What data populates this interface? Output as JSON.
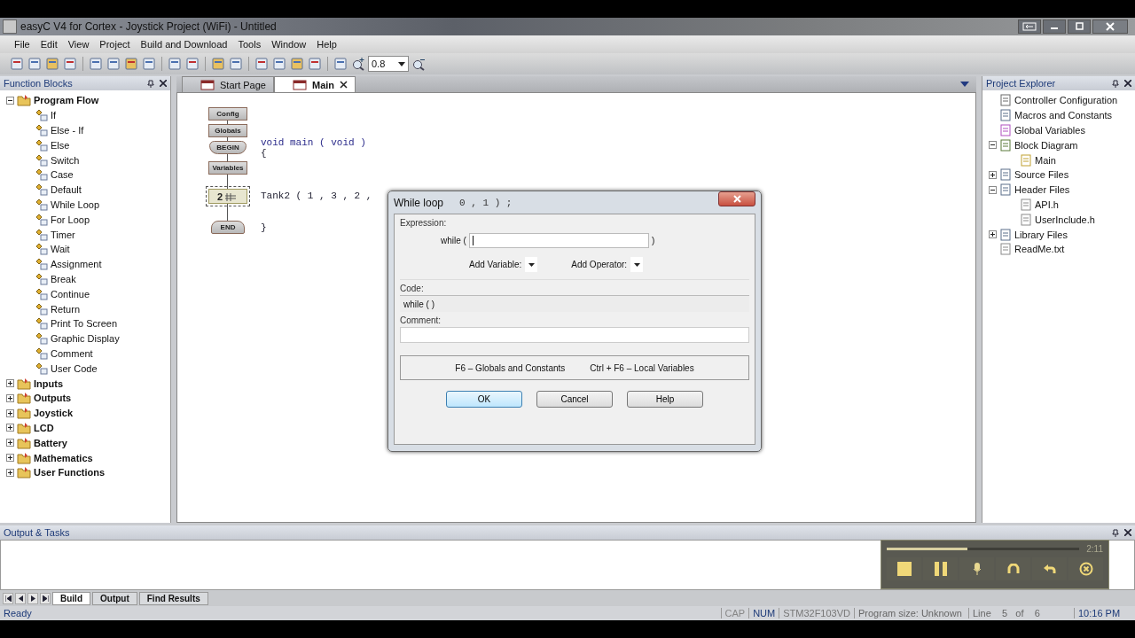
{
  "window": {
    "title": "easyC V4 for Cortex - Joystick Project (WiFi) - Untitled"
  },
  "menu": [
    "File",
    "Edit",
    "View",
    "Project",
    "Build and Download",
    "Tools",
    "Window",
    "Help"
  ],
  "toolbar": {
    "zoom_value": "0.8"
  },
  "function_blocks": {
    "title": "Function Blocks",
    "groups": [
      {
        "label": "Program Flow",
        "expanded": true,
        "children": [
          "If",
          "Else - If",
          "Else",
          "Switch",
          "Case",
          "Default",
          "While Loop",
          "For Loop",
          "Timer",
          "Wait",
          "Assignment",
          "Break",
          "Continue",
          "Return",
          "Print To Screen",
          "Graphic Display",
          "Comment",
          "User Code"
        ]
      },
      {
        "label": "Inputs",
        "expanded": false
      },
      {
        "label": "Outputs",
        "expanded": false
      },
      {
        "label": "Joystick",
        "expanded": false
      },
      {
        "label": "LCD",
        "expanded": false
      },
      {
        "label": "Battery",
        "expanded": false
      },
      {
        "label": "Mathematics",
        "expanded": false
      },
      {
        "label": "User Functions",
        "expanded": false
      }
    ]
  },
  "editor_tabs": [
    {
      "label": "Start Page",
      "selected": false
    },
    {
      "label": "Main",
      "selected": true
    }
  ],
  "diagram": {
    "blocks": [
      {
        "kind": "rect",
        "label": "Config"
      },
      {
        "kind": "rect",
        "label": "Globals"
      },
      {
        "kind": "begin",
        "label": "BEGIN"
      },
      {
        "kind": "rect",
        "label": "Variables"
      },
      {
        "kind": "call",
        "label": "2"
      },
      {
        "kind": "end",
        "label": "END"
      }
    ],
    "code": [
      "void main ( void )",
      "{",
      "Tank2 ( 1 , 3 , 2 ,",
      "}"
    ]
  },
  "dialog": {
    "title": "While loop",
    "behind_text": "0 , 1 ) ;",
    "expression_label": "Expression:",
    "while_label": "while (",
    "close_paren": ")",
    "add_variable": "Add Variable:",
    "add_operator": "Add Operator:",
    "code_label": "Code:",
    "code_value": "while ( )",
    "comment_label": "Comment:",
    "hint_1": "F6 – Globals and Constants",
    "hint_2": "Ctrl + F6 – Local Variables",
    "buttons": [
      "OK",
      "Cancel",
      "Help"
    ]
  },
  "project_explorer": {
    "title": "Project Explorer",
    "items": [
      {
        "label": "Controller Configuration"
      },
      {
        "label": "Macros and Constants"
      },
      {
        "label": "Global Variables"
      },
      {
        "label": "Block Diagram",
        "expanded": true,
        "children": [
          {
            "label": "Main"
          }
        ]
      },
      {
        "label": "Source Files",
        "expanded": false
      },
      {
        "label": "Header Files",
        "expanded": true,
        "children": [
          {
            "label": "API.h"
          },
          {
            "label": "UserInclude.h"
          }
        ]
      },
      {
        "label": "Library Files",
        "expanded": false
      },
      {
        "label": "ReadMe.txt"
      }
    ]
  },
  "output": {
    "title": "Output & Tasks",
    "tabs": [
      {
        "label": "Build",
        "selected": true
      },
      {
        "label": "Output",
        "selected": false
      },
      {
        "label": "Find Results",
        "selected": false
      }
    ]
  },
  "status_bar": {
    "ready": "Ready",
    "indicators": [
      {
        "label": "CAP",
        "on": false
      },
      {
        "label": "NUM",
        "on": true
      }
    ],
    "device": "STM32F103VD",
    "program_size": "Program size: Unknown",
    "line": "Line    5   of    6",
    "time": "10:16 PM"
  },
  "recorder": {
    "time": "2:11",
    "progress": {
      "level": 0.42
    }
  }
}
